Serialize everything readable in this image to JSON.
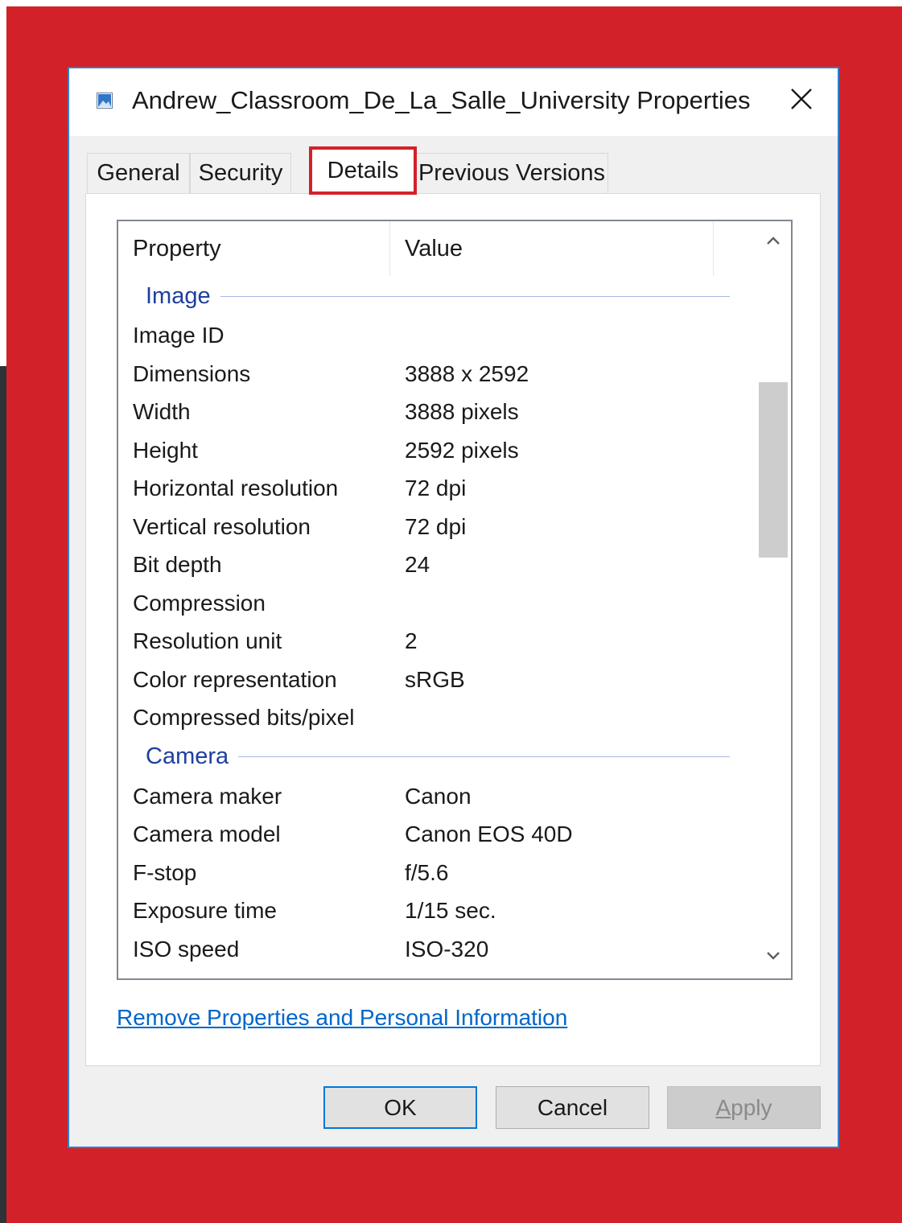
{
  "dialog": {
    "title": "Andrew_Classroom_De_La_Salle_University Properties",
    "close_label": "✕"
  },
  "tabs": [
    {
      "label": "General"
    },
    {
      "label": "Security"
    },
    {
      "label": "Details",
      "active": true
    },
    {
      "label": "Previous Versions"
    }
  ],
  "list": {
    "headers": {
      "property": "Property",
      "value": "Value"
    },
    "groups": [
      {
        "name": "Image",
        "rows": [
          {
            "property": "Image ID",
            "value": ""
          },
          {
            "property": "Dimensions",
            "value": "3888 x 2592"
          },
          {
            "property": "Width",
            "value": "3888 pixels"
          },
          {
            "property": "Height",
            "value": "2592 pixels"
          },
          {
            "property": "Horizontal resolution",
            "value": "72 dpi"
          },
          {
            "property": "Vertical resolution",
            "value": "72 dpi"
          },
          {
            "property": "Bit depth",
            "value": "24"
          },
          {
            "property": "Compression",
            "value": ""
          },
          {
            "property": "Resolution unit",
            "value": "2"
          },
          {
            "property": "Color representation",
            "value": "sRGB"
          },
          {
            "property": "Compressed bits/pixel",
            "value": ""
          }
        ]
      },
      {
        "name": "Camera",
        "rows": [
          {
            "property": "Camera maker",
            "value": "Canon"
          },
          {
            "property": "Camera model",
            "value": "Canon EOS 40D"
          },
          {
            "property": "F-stop",
            "value": "f/5.6"
          },
          {
            "property": "Exposure time",
            "value": "1/15 sec."
          },
          {
            "property": "ISO speed",
            "value": "ISO-320"
          }
        ]
      }
    ]
  },
  "link": {
    "remove": "Remove Properties and Personal Information"
  },
  "buttons": {
    "ok": "OK",
    "cancel": "Cancel",
    "apply_prefix": "A",
    "apply_rest": "pply"
  },
  "colors": {
    "background": "#d22129",
    "highlight": "#d22129",
    "accent": "#0078d7",
    "group_header": "#1e3f9e",
    "link": "#0066cc"
  },
  "icons": {
    "title": "image-file-icon",
    "close": "close-icon",
    "scroll_up": "chevron-up-icon",
    "scroll_down": "chevron-down-icon"
  }
}
